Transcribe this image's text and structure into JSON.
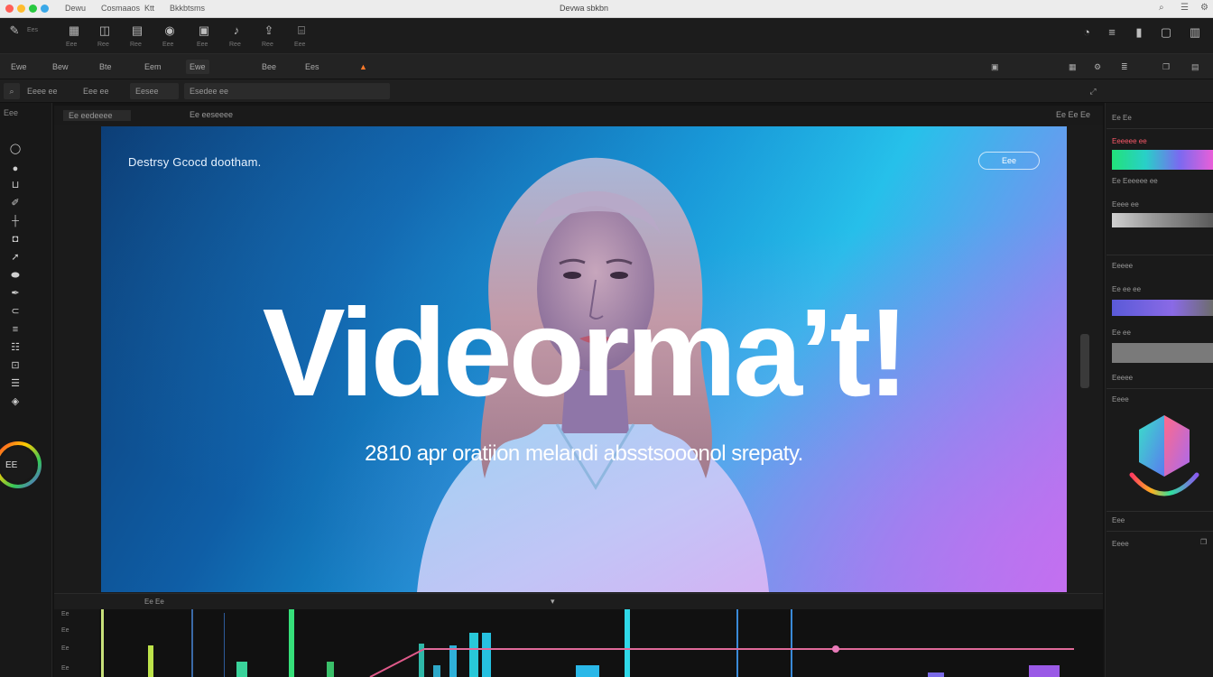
{
  "window": {
    "menus": [
      "Dewu",
      "Cosmaaos",
      "Ktt",
      "Bkkbtsms"
    ],
    "title": "Devwa sbkbn"
  },
  "toolbar": {
    "items": [
      {
        "icon": "pen-icon",
        "label": "Ees"
      },
      {
        "icon": "grid-icon",
        "label": "Eee"
      },
      {
        "icon": "layers-icon",
        "label": "Ree"
      },
      {
        "icon": "film-icon",
        "label": "Ree"
      },
      {
        "icon": "camera-icon",
        "label": "Eee"
      },
      {
        "icon": "color-icon",
        "label": "Eee"
      },
      {
        "icon": "audio-icon",
        "label": "Ree"
      },
      {
        "icon": "export-icon",
        "label": "Ree"
      },
      {
        "icon": "deliver-icon",
        "label": "Eee"
      }
    ]
  },
  "row2": {
    "buttons": [
      "Ewe",
      "Bew",
      "Bte",
      "Eem",
      "Ewe",
      "Bee",
      "Ees"
    ],
    "active": "Ewe"
  },
  "row3": {
    "search_placeholder": "Eeee ee",
    "field2": "Eee ee",
    "field3": "Eesee",
    "clip_name": "Esedee ee"
  },
  "left_rail": {
    "header": "Eee",
    "wheel_label": "EE"
  },
  "viewer": {
    "tab": "Ee eedeeee",
    "timecode": "Ee eeseeee",
    "zoom": "Ee Ee Ee"
  },
  "frame": {
    "top_label": "Destrsy Gcocd dootham.",
    "button": "Eee",
    "headline": "Videorma’t!",
    "subline": "2810 apr oratiion melandi absstsooonol srepaty."
  },
  "right_panel": {
    "sections": [
      "Ee Ee",
      "Eeeee",
      "Ee ee",
      "Eeeee",
      "Eeee",
      "Eee",
      "Eeee"
    ],
    "rows": [
      "Eeeeee ee",
      "Ee Eeeeee ee",
      "Eeee ee",
      "Ee ee ee"
    ],
    "colors": {
      "rainbow": "#22e0b0",
      "purple": "#7b6be0",
      "gray": "#8a8a8a"
    }
  },
  "timeline": {
    "head_label": "Ee Ee",
    "track_labels": [
      "Ee",
      "Ee",
      "Ee",
      "Ee"
    ]
  }
}
